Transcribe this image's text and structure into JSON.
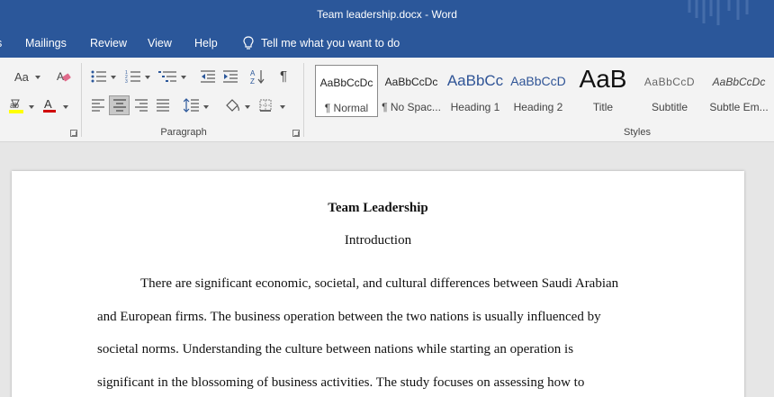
{
  "window": {
    "title": "Team leadership.docx  -  Word"
  },
  "menu": {
    "tabs": [
      "Mailings",
      "Review",
      "View",
      "Help"
    ],
    "tell_me": "Tell me what you want to do"
  },
  "ribbon": {
    "paragraph_label": "Paragraph",
    "styles_label": "Styles",
    "font_size_glyph": "Aa",
    "styles": [
      {
        "sample": "AaBbCcDc",
        "name": "¶ Normal"
      },
      {
        "sample": "AaBbCcDc",
        "name": "¶ No Spac..."
      },
      {
        "sample": "AaBbCc",
        "name": "Heading 1"
      },
      {
        "sample": "AaBbCcD",
        "name": "Heading 2"
      },
      {
        "sample": "AaB",
        "name": "Title"
      },
      {
        "sample": "AaBbCcD",
        "name": "Subtitle"
      },
      {
        "sample": "AaBbCcDc",
        "name": "Subtle Em..."
      }
    ]
  },
  "document": {
    "title": "Team Leadership",
    "subtitle": "Introduction",
    "lines": [
      "There are significant economic, societal, and cultural differences between Saudi Arabian",
      "and European firms. The business operation between the two nations is usually influenced by",
      "societal norms. Understanding the culture between nations while starting an operation is",
      "significant in the blossoming of business activities. The study focuses on assessing how to"
    ]
  },
  "colors": {
    "word_blue": "#2b579a",
    "ribbon_bg": "#f3f3f3",
    "heading_blue": "#2f5496"
  }
}
